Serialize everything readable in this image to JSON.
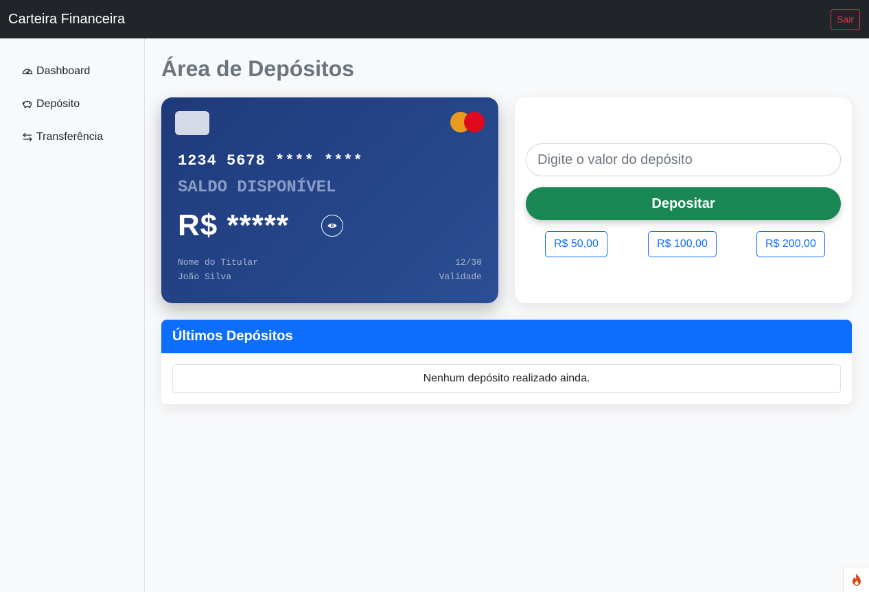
{
  "navbar": {
    "brand": "Carteira Financeira",
    "logout_label": "Sair"
  },
  "sidebar": {
    "items": [
      {
        "label": "Dashboard",
        "icon": "speedometer-icon"
      },
      {
        "label": "Depósito",
        "icon": "piggy-bank-icon"
      },
      {
        "label": "Transferência",
        "icon": "arrow-left-right-icon"
      }
    ]
  },
  "page": {
    "title": "Área de Depósitos"
  },
  "card": {
    "number": "1234 5678 **** ****",
    "balance_label": "SALDO DISPONÍVEL",
    "balance_value": "R$ *****",
    "holder_label": "Nome do Titular",
    "holder_name": "João Silva",
    "expiry": "12/30",
    "expiry_label": "Validade",
    "brand_icon": "mastercard-icon"
  },
  "deposit": {
    "placeholder": "Digite o valor do depósito",
    "value": "",
    "button_label": "Depositar",
    "quick_amounts": [
      "R$ 50,00",
      "R$ 100,00",
      "R$ 200,00"
    ]
  },
  "history": {
    "title": "Últimos Depósitos",
    "empty_message": "Nenhum depósito realizado ainda."
  },
  "colors": {
    "navbar_bg": "#212529",
    "danger": "#dc3545",
    "primary": "#0d6efd",
    "success": "#198754",
    "card_bg": "#1e3a7b",
    "title_gray": "#6c757d"
  }
}
